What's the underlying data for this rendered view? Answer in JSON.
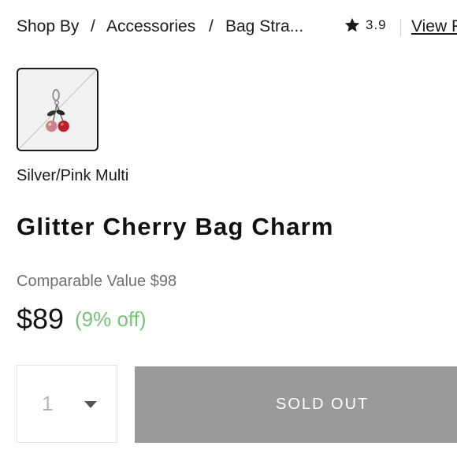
{
  "breadcrumb": {
    "items": [
      "Shop By",
      "Accessories",
      "Bag Stra..."
    ],
    "separator": "/"
  },
  "rating": {
    "value": "3.9",
    "icon": "star-icon"
  },
  "reviews_link": "View R",
  "swatch": {
    "selected": true,
    "image": "cherry-charm-thumbnail"
  },
  "color_name": "Silver/Pink Multi",
  "product_title": "Glitter Cherry Bag Charm",
  "comparable_value": "Comparable Value $98",
  "price": "$89",
  "discount": "(9% off)",
  "quantity": {
    "value": "1"
  },
  "sold_out_label": "SOLD OUT",
  "colors": {
    "discount_green": "#7ac27a",
    "sold_out_gray": "#9a9a9a",
    "comparable_gray": "#6f6f6f"
  }
}
